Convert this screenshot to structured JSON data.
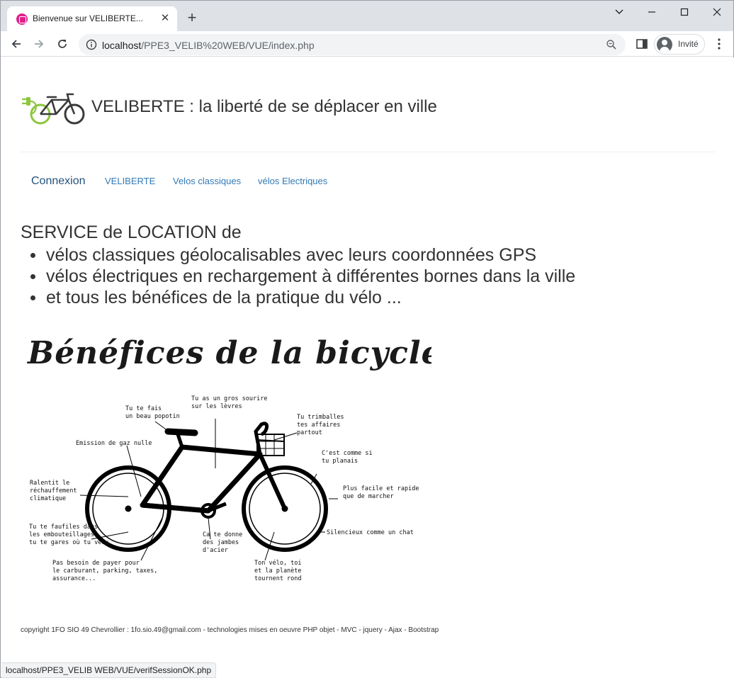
{
  "browser": {
    "tab_title": "Bienvenue sur VELIBERTE...",
    "tab_close": "✕",
    "new_tab": "+",
    "url_host": "localhost",
    "url_path": "/PPE3_VELIB%20WEB/VUE/index.php",
    "profile_label": "Invité",
    "status_url": "localhost/PPE3_VELIB WEB/VUE/verifSessionOK.php"
  },
  "colors": {
    "brand_green": "#8dc63f",
    "link": "#337ab7",
    "text": "#333333"
  },
  "header": {
    "title": "VELIBERTE : la liberté de se déplacer en ville",
    "logo_icon": "electric-bike-logo"
  },
  "nav": {
    "items": [
      {
        "label": "Connexion"
      },
      {
        "label": "VELIBERTE"
      },
      {
        "label": "Velos classiques"
      },
      {
        "label": "vélos Electriques"
      }
    ]
  },
  "content": {
    "intro": "SERVICE de LOCATION de",
    "services": [
      "vélos classiques géolocalisables avec leurs coordonnées GPS",
      "vélos électriques en rechargement à différentes bornes dans la ville",
      "et tous les bénéfices de la pratique du vélo ..."
    ]
  },
  "figure": {
    "title": "Bénéfices de la bicyclette",
    "labels": {
      "popotin": [
        "Tu te fais",
        "un beau popotin"
      ],
      "sourire": [
        "Tu as un gros sourire",
        "sur les lèvres"
      ],
      "affaires": [
        "Tu trimballes",
        "tes affaires",
        "partout"
      ],
      "gaz": [
        "Emission de gaz nulle"
      ],
      "planais": [
        "C'est comme si",
        "tu planais"
      ],
      "rechauffement": [
        "Ralentit le",
        "réchauffement",
        "climatique"
      ],
      "marcher": [
        "Plus facile et rapide",
        "que de marcher"
      ],
      "chat": [
        "Silencieux comme un chat"
      ],
      "embouteillages": [
        "Tu te faufiles dans",
        "les embouteillages,",
        "tu te gares où tu veux"
      ],
      "jambes": [
        "Ca te donne",
        "des jambes",
        "d'acier"
      ],
      "carburant": [
        "Pas besoin de payer pour",
        "le carburant, parking, taxes,",
        "assurance..."
      ],
      "planete": [
        "Ton vélo, toi",
        "et la planète",
        "tournent rond"
      ]
    }
  },
  "footer": {
    "text": "copyright 1FO SIO 49 Chevrollier : 1fo.sio.49@gmail.com - technologies mises en oeuvre PHP objet - MVC - jquery - Ajax - Bootstrap"
  }
}
